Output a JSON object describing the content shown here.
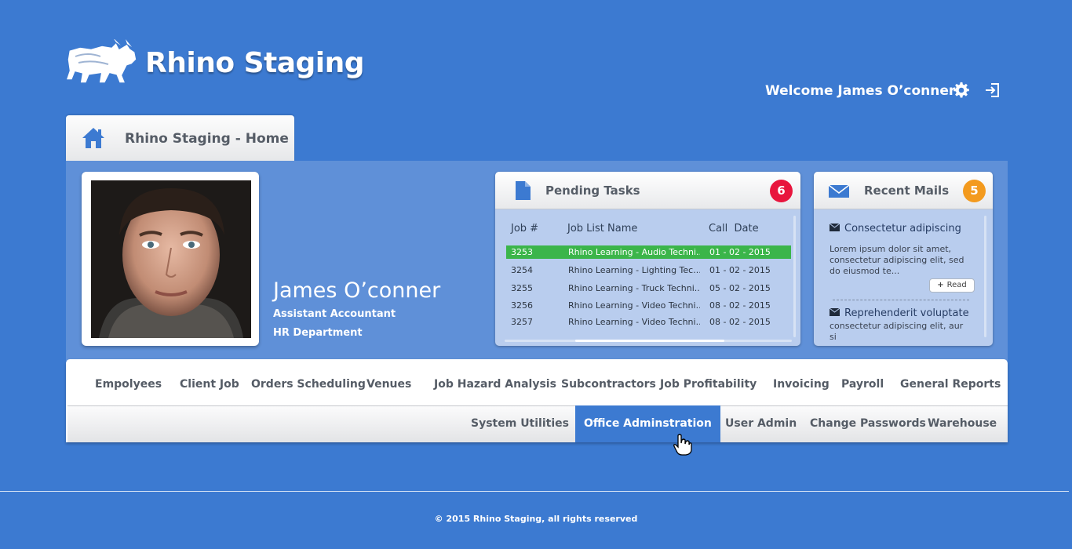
{
  "header": {
    "brand": "Rhino Staging",
    "welcome": "Welcome James O’conner",
    "settings_icon": "gear-icon",
    "logout_icon": "logout-icon"
  },
  "home_tab": {
    "label": "Rhino Staging - Home",
    "icon": "home-icon"
  },
  "profile": {
    "name": "James O’conner",
    "role": "Assistant Accountant",
    "department": "HR Department"
  },
  "pending_tasks": {
    "title": "Pending Tasks",
    "count": "6",
    "badge_color": "#e8153d",
    "columns": [
      "Job #",
      "Job List Name",
      "Call  Date"
    ],
    "rows": [
      {
        "job": "3253",
        "name": "Rhino Learning - Audio Techni...",
        "date": "01 - 02 - 2015"
      },
      {
        "job": "3254",
        "name": "Rhino Learning - Lighting Tec...",
        "date": "01 - 02 - 2015"
      },
      {
        "job": "3255",
        "name": "Rhino Learning -  Truck Techni...",
        "date": "05 - 02 - 2015"
      },
      {
        "job": "3256",
        "name": "Rhino Learning - Video Techni...",
        "date": "08 - 02 - 2015"
      },
      {
        "job": "3257",
        "name": "Rhino Learning - Video Techni...",
        "date": "08 - 02 - 2015"
      }
    ]
  },
  "recent_mails": {
    "title": "Recent Mails",
    "count": "5",
    "badge_color": "#f39a1e",
    "mails": [
      {
        "subject": "Consectetur adipiscing",
        "body": "Lorem ipsum dolor sit amet, consectetur adipiscing elit, sed do eiusmod te..."
      },
      {
        "subject": "Reprehenderit voluptate",
        "body": "consectetur adipiscing elit, aur si"
      }
    ],
    "read_label": "Read"
  },
  "menu": {
    "row1": [
      "Empolyees",
      "Client Job",
      "Orders Scheduling",
      "Venues",
      "Job Hazard Analysis",
      "Subcontractors",
      "Job Profitability",
      "Invoicing",
      "Payroll",
      "General Reports"
    ],
    "row2": [
      "System Utilities",
      "Office Adminstration",
      "User Admin",
      "Change Passwords",
      "Warehouse"
    ],
    "active": "Office Adminstration"
  },
  "footer": {
    "copyright": "© 2015 Rhino Staging, all rights reserved"
  },
  "colors": {
    "background": "#3c7ad1",
    "panel": "#5f90d8",
    "selected_row": "#3bb54a"
  }
}
